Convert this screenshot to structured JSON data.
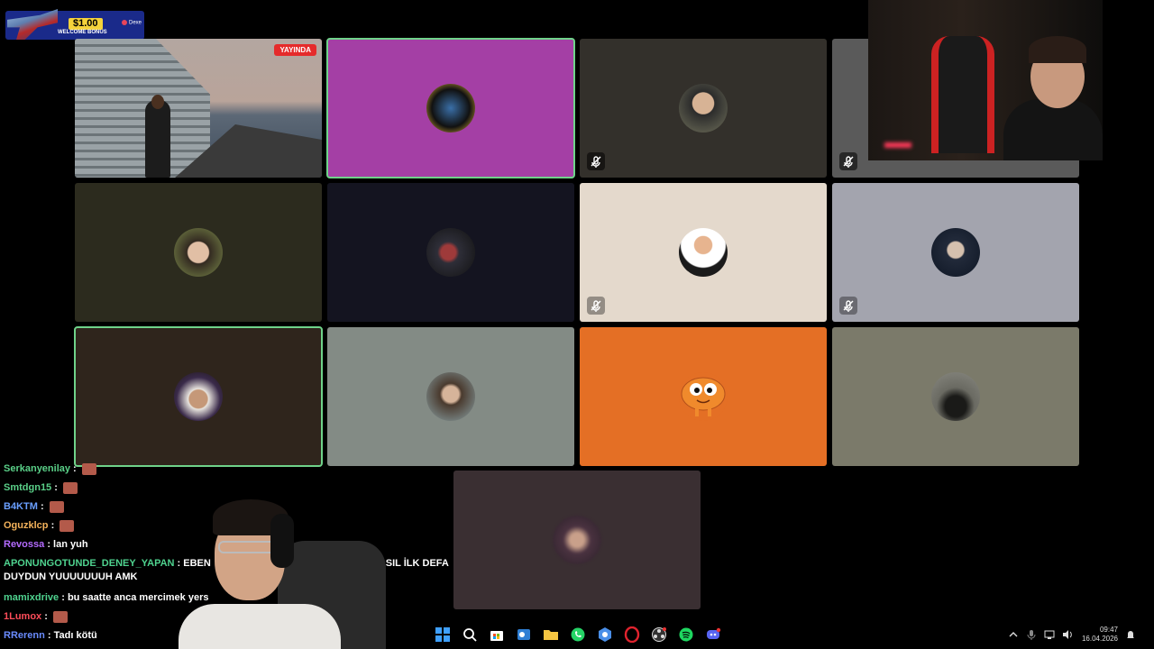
{
  "promo": {
    "amount": "$1.00",
    "bonus_text": "WELCOME BONUS",
    "brand": "Dexe"
  },
  "tiles": [
    {
      "id": "game",
      "live_label": "YAYINDA",
      "color": "#7c8a96",
      "muted": false
    },
    {
      "id": "p2",
      "color": "#a43fa5",
      "muted": false,
      "active": true
    },
    {
      "id": "p3",
      "color": "#33302b",
      "muted": true
    },
    {
      "id": "p4",
      "color": "#5a5a5a",
      "muted": true
    },
    {
      "id": "p5",
      "color": "#2c2b1e",
      "muted": false
    },
    {
      "id": "p6",
      "color": "#141420",
      "muted": false
    },
    {
      "id": "p7",
      "color": "#e4d9cc",
      "muted": true
    },
    {
      "id": "p8",
      "color": "#a3a4ae",
      "muted": true
    },
    {
      "id": "p9",
      "color": "#2f251c",
      "muted": false,
      "active": true
    },
    {
      "id": "p10",
      "color": "#838b85",
      "muted": false
    },
    {
      "id": "p11",
      "color": "#e46f25",
      "muted": false
    },
    {
      "id": "p12",
      "color": "#7b7a6a",
      "muted": false
    },
    {
      "id": "p13",
      "color": "#3a2f32",
      "muted": false
    }
  ],
  "chat": [
    {
      "user": "Serkanyenilay",
      "color": "#5ad088",
      "text": "",
      "emote": true
    },
    {
      "user": "Smtdgn15",
      "color": "#5ad088",
      "text": "",
      "emote": true
    },
    {
      "user": "B4KTM",
      "color": "#6a9fff",
      "text": "",
      "emote": true
    },
    {
      "user": "Oguzklcp",
      "color": "#f3b25b",
      "text": "",
      "emote": true
    },
    {
      "user": "Revossa",
      "color": "#b46bff",
      "text": "lan yuh",
      "emote": false
    },
    {
      "user": "APONUNGOTUNDE_DENEY_YAPAN",
      "color": "#4fd38f",
      "text": "EBEN",
      "emote": false
    },
    {
      "user": "",
      "color": "#ffffff",
      "text": "DUYDUN YUUUUUUUH AMK",
      "emote": false
    },
    {
      "user": "mamixdrive",
      "color": "#4fd38f",
      "text": "bu saatte anca mercimek yers",
      "emote": false
    },
    {
      "user": "1Lumox",
      "color": "#ff4d5a",
      "text": "",
      "emote": true
    },
    {
      "user": "RRerenn",
      "color": "#6a8cff",
      "text": "Tadı kötü",
      "emote": false
    }
  ],
  "chat_fragment": "ASIL İLK DEFA",
  "taskbar": [
    "windows-start",
    "search",
    "store",
    "outlook",
    "file-explorer",
    "whatsapp",
    "app-blue",
    "opera",
    "obs",
    "spotify",
    "discord"
  ],
  "clock": {
    "time": "09:47",
    "date": "16.04.2026"
  }
}
